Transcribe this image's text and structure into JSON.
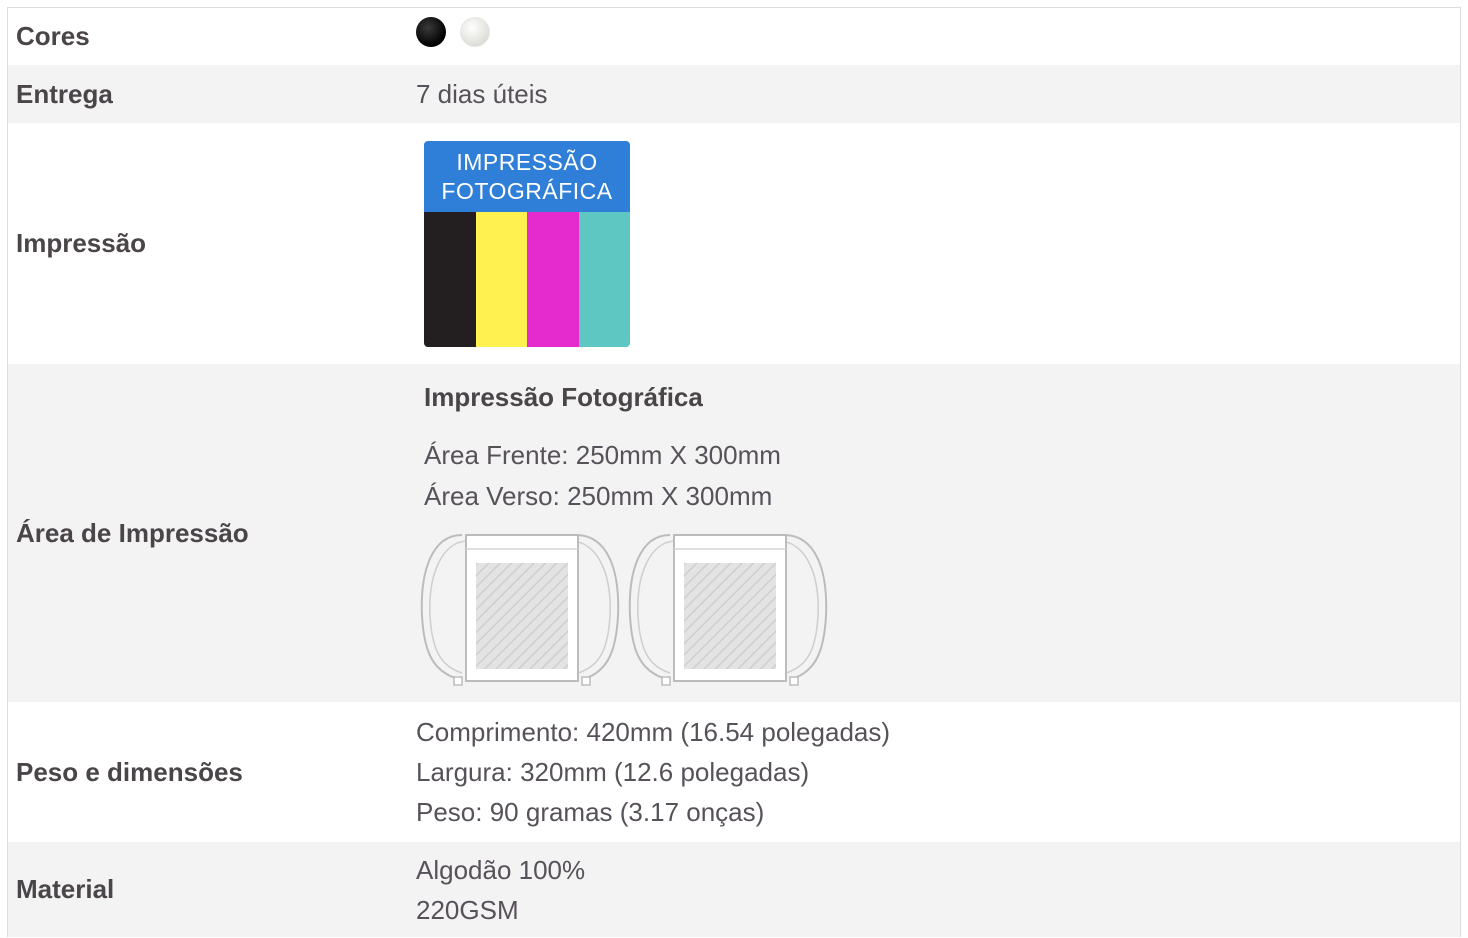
{
  "rows": {
    "cores": {
      "label": "Cores",
      "colors": [
        "#000000",
        "#f2f1ec"
      ]
    },
    "entrega": {
      "label": "Entrega",
      "value": "7 dias úteis"
    },
    "impressao": {
      "label": "Impressão",
      "badge_line1": "IMPRESSÃO",
      "badge_line2": "FOTOGRÁFICA",
      "badge_head_color": "#2f7fd8",
      "bar_colors": [
        "#231f20",
        "#fff14f",
        "#e62bce",
        "#5ec7c1"
      ]
    },
    "area": {
      "label": "Área de Impressão",
      "title": "Impressão Fotográfica",
      "front": "Área Frente: 250mm X 300mm",
      "back": "Área Verso: 250mm X 300mm"
    },
    "peso": {
      "label": "Peso e dimensões",
      "length": "Comprimento: 420mm (16.54 polegadas)",
      "width": "Largura: 320mm (12.6 polegadas)",
      "weight": "Peso: 90 gramas (3.17 onças)"
    },
    "material": {
      "label": "Material",
      "line1": "Algodão 100%",
      "line2": "220GSM"
    }
  }
}
